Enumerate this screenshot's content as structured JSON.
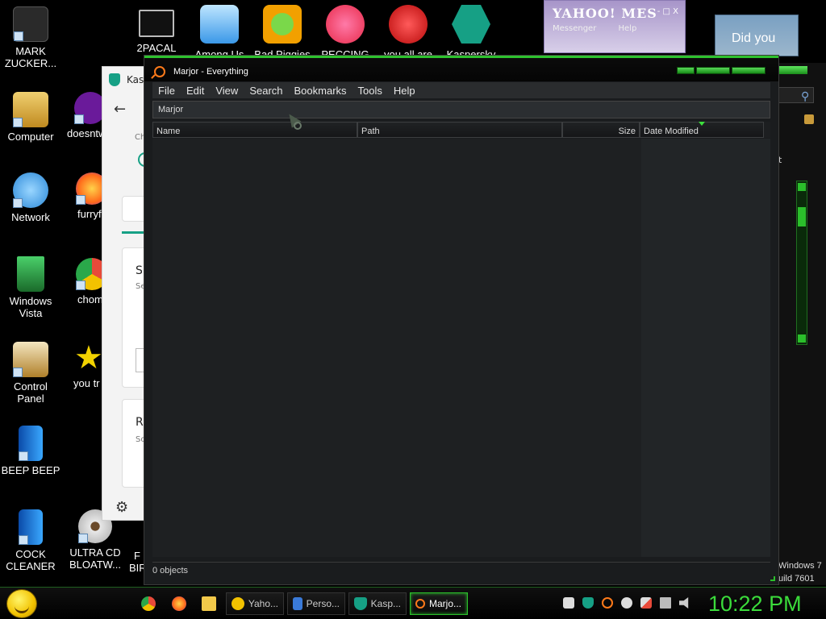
{
  "desktop": {
    "left_icons": [
      {
        "label": "MARK ZUCKER...",
        "icon": "person-file-icon",
        "color": "#333333"
      },
      {
        "label": "Computer",
        "icon": "computer-icon",
        "color": "#e0b040"
      },
      {
        "label": "Network",
        "icon": "network-icon",
        "color": "#4aa8e8"
      },
      {
        "label": "Windows Vista",
        "icon": "recycle-bin-icon",
        "color": "#2a8a3a"
      },
      {
        "label": "Control Panel",
        "icon": "control-panel-icon",
        "color": "#c89a3a"
      },
      {
        "label": "BEEP BEEP",
        "icon": "blue-file-icon",
        "color": "#1a7ad8"
      },
      {
        "label": "COCK CLEANER",
        "icon": "blue-file-icon",
        "color": "#1a7ad8"
      }
    ],
    "second_column": [
      {
        "label": "doesntw",
        "icon": "yahoo-icon",
        "color": "#6a1a9a"
      },
      {
        "label": "furryf",
        "icon": "firefox-icon",
        "color": "#ff7a1a"
      },
      {
        "label": "chom",
        "icon": "chrome-icon",
        "color": "#2a8ae8"
      },
      {
        "label": "you tr",
        "icon": "star-icon",
        "color": "#f2d200"
      },
      {
        "label": "ULTRA CD BLOATW...",
        "icon": "cd-icon",
        "color": "#bbbbbb"
      }
    ],
    "third_partial": [
      {
        "label": "F"
      },
      {
        "label": "BIR"
      }
    ],
    "top_icons": [
      {
        "label": "2PACAL",
        "icon": "terminal-icon",
        "color": "#222222"
      },
      {
        "label": "Among Us",
        "icon": "game-icon",
        "color": "#4aa8e8"
      },
      {
        "label": "Bad Piggies",
        "icon": "pig-icon",
        "color": "#f2a000"
      },
      {
        "label": "PECCING",
        "icon": "p-logo-icon",
        "color": "#e84a4a"
      },
      {
        "label": "you all are",
        "icon": "dev-cpp-icon",
        "color": "#d82a2a"
      },
      {
        "label": "Kaspersky",
        "icon": "kaspersky-icon",
        "color": "#16a085"
      }
    ]
  },
  "yahoo_messenger": {
    "title": "YAHOO! MES",
    "menu": [
      "Messenger",
      "Help"
    ],
    "controls": "- □ X"
  },
  "did_you_popup": {
    "text": "Did you"
  },
  "kaspersky_window": {
    "title": "Kasp",
    "partial_texts": [
      "Ch",
      "S",
      "Se",
      "R",
      "So"
    ]
  },
  "right_window": {
    "text_lines": [
      "Windows 7",
      "uild 7601"
    ],
    "partial_letter": "t"
  },
  "everything": {
    "title": "Marjor - Everything",
    "menu": [
      "File",
      "Edit",
      "View",
      "Search",
      "Bookmarks",
      "Tools",
      "Help"
    ],
    "search_value": "Marjor",
    "columns": [
      "Name",
      "Path",
      "Size",
      "Date Modified"
    ],
    "status": "0 objects",
    "accent": "#2ec22e"
  },
  "taskbar": {
    "buttons": [
      {
        "label": "Yaho...",
        "icon": "yahoo-smiley-icon",
        "color": "#f2c200",
        "active": false
      },
      {
        "label": "Perso...",
        "icon": "monitor-icon",
        "color": "#3a7ad8",
        "active": false
      },
      {
        "label": "Kasp...",
        "icon": "kaspersky-shield-icon",
        "color": "#16a085",
        "active": false
      },
      {
        "label": "Marjo...",
        "icon": "everything-search-icon",
        "color": "#ff7a1a",
        "active": true
      }
    ],
    "clock": "10:22 PM"
  }
}
